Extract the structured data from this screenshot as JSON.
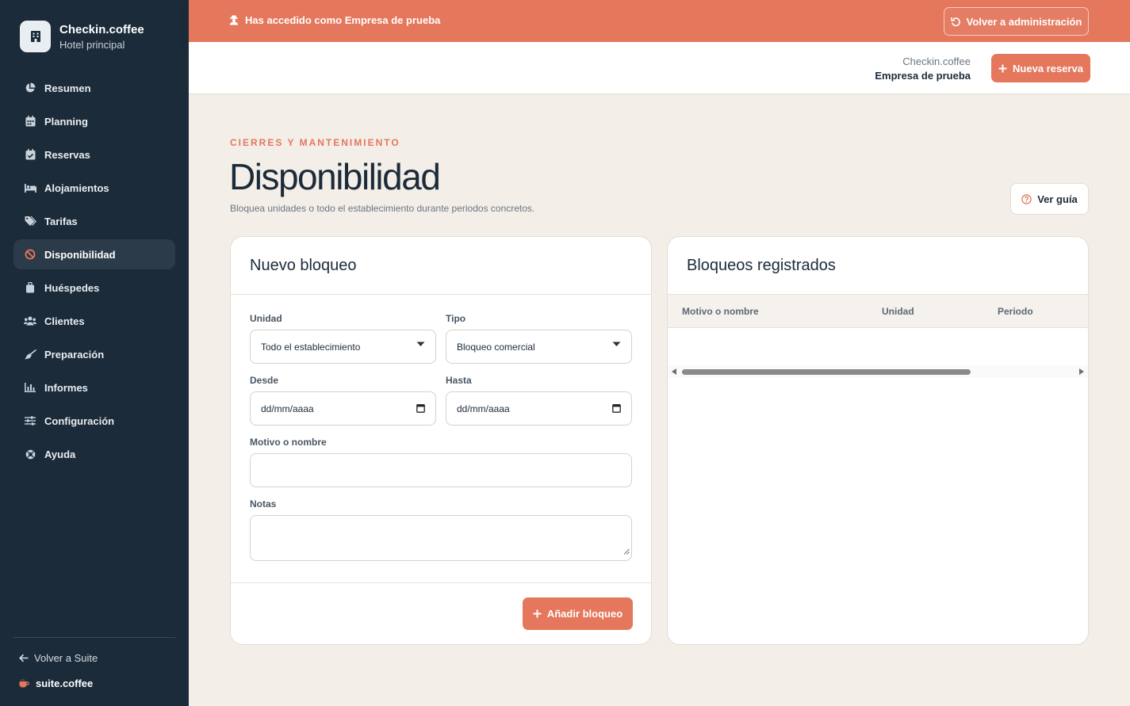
{
  "sidebar": {
    "brand_name": "Checkin.coffee",
    "brand_sub": "Hotel principal",
    "items": [
      {
        "label": "Resumen",
        "icon": "chart-pie-icon"
      },
      {
        "label": "Planning",
        "icon": "calendar-grid-icon"
      },
      {
        "label": "Reservas",
        "icon": "calendar-check-icon"
      },
      {
        "label": "Alojamientos",
        "icon": "bed-icon"
      },
      {
        "label": "Tarifas",
        "icon": "tags-icon"
      },
      {
        "label": "Disponibilidad",
        "icon": "ban-icon",
        "active": true
      },
      {
        "label": "Huéspedes",
        "icon": "suitcase-icon"
      },
      {
        "label": "Clientes",
        "icon": "users-icon"
      },
      {
        "label": "Preparación",
        "icon": "broom-icon"
      },
      {
        "label": "Informes",
        "icon": "bar-chart-icon"
      },
      {
        "label": "Configuración",
        "icon": "sliders-icon"
      },
      {
        "label": "Ayuda",
        "icon": "lifebuoy-icon"
      }
    ],
    "back_label": "Volver a Suite",
    "suite_label": "suite.coffee"
  },
  "banner": {
    "message": "Has accedido como Empresa de prueba",
    "back_admin": "Volver a administración"
  },
  "header": {
    "app_name": "Checkin.coffee",
    "company": "Empresa de prueba",
    "new_booking": "Nueva reserva"
  },
  "page": {
    "eyebrow": "CIERRES Y MANTENIMIENTO",
    "title": "Disponibilidad",
    "subtitle": "Bloquea unidades o todo el establecimiento durante periodos concretos.",
    "guide": "Ver guía"
  },
  "form": {
    "title": "Nuevo bloqueo",
    "unit_label": "Unidad",
    "unit_value": "Todo el establecimiento",
    "type_label": "Tipo",
    "type_value": "Bloqueo comercial",
    "from_label": "Desde",
    "from_value": "dd/mm/aaaa",
    "to_label": "Hasta",
    "to_value": "dd/mm/aaaa",
    "reason_label": "Motivo o nombre",
    "reason_value": "",
    "notes_label": "Notas",
    "notes_value": "",
    "submit": "Añadir bloqueo"
  },
  "table": {
    "title": "Bloqueos registrados",
    "columns": [
      "Motivo o nombre",
      "Unidad",
      "Periodo"
    ],
    "rows": []
  },
  "colors": {
    "accent": "#e4775c",
    "sidebar_bg": "#1c2b39",
    "page_bg": "#f3efe8"
  }
}
